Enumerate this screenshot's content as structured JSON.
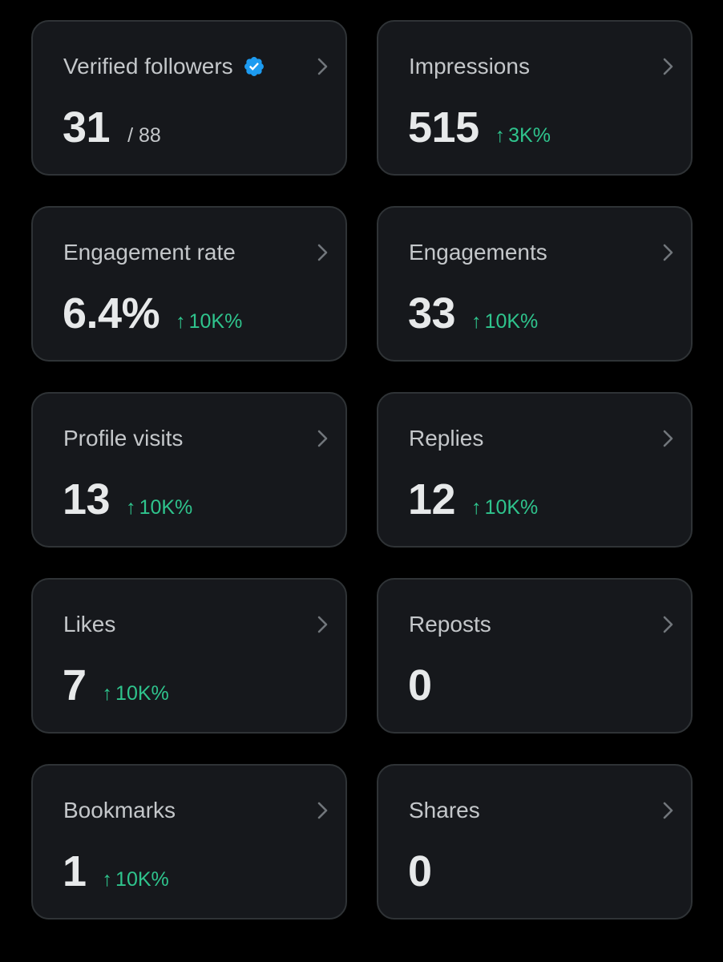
{
  "colors": {
    "background": "#000000",
    "card": "#16181c",
    "card_border": "#2f3336",
    "label": "#c4c7ca",
    "value": "#e7e9ea",
    "delta_up": "#2fc48d",
    "verified": "#1d9bf0"
  },
  "icons": {
    "verified": "verified-badge-icon",
    "chevron": "chevron-right-icon",
    "delta": "arrow-up-icon"
  },
  "metrics": {
    "verified_followers": {
      "label": "Verified followers",
      "value": "31",
      "denominator": "/ 88"
    },
    "impressions": {
      "label": "Impressions",
      "value": "515",
      "arrow": "↑",
      "delta": "3K%"
    },
    "engagement_rate": {
      "label": "Engagement rate",
      "value": "6.4%",
      "arrow": "↑",
      "delta": "10K%"
    },
    "engagements": {
      "label": "Engagements",
      "value": "33",
      "arrow": "↑",
      "delta": "10K%"
    },
    "profile_visits": {
      "label": "Profile visits",
      "value": "13",
      "arrow": "↑",
      "delta": "10K%"
    },
    "replies": {
      "label": "Replies",
      "value": "12",
      "arrow": "↑",
      "delta": "10K%"
    },
    "likes": {
      "label": "Likes",
      "value": "7",
      "arrow": "↑",
      "delta": "10K%"
    },
    "reposts": {
      "label": "Reposts",
      "value": "0"
    },
    "bookmarks": {
      "label": "Bookmarks",
      "value": "1",
      "arrow": "↑",
      "delta": "10K%"
    },
    "shares": {
      "label": "Shares",
      "value": "0"
    }
  }
}
